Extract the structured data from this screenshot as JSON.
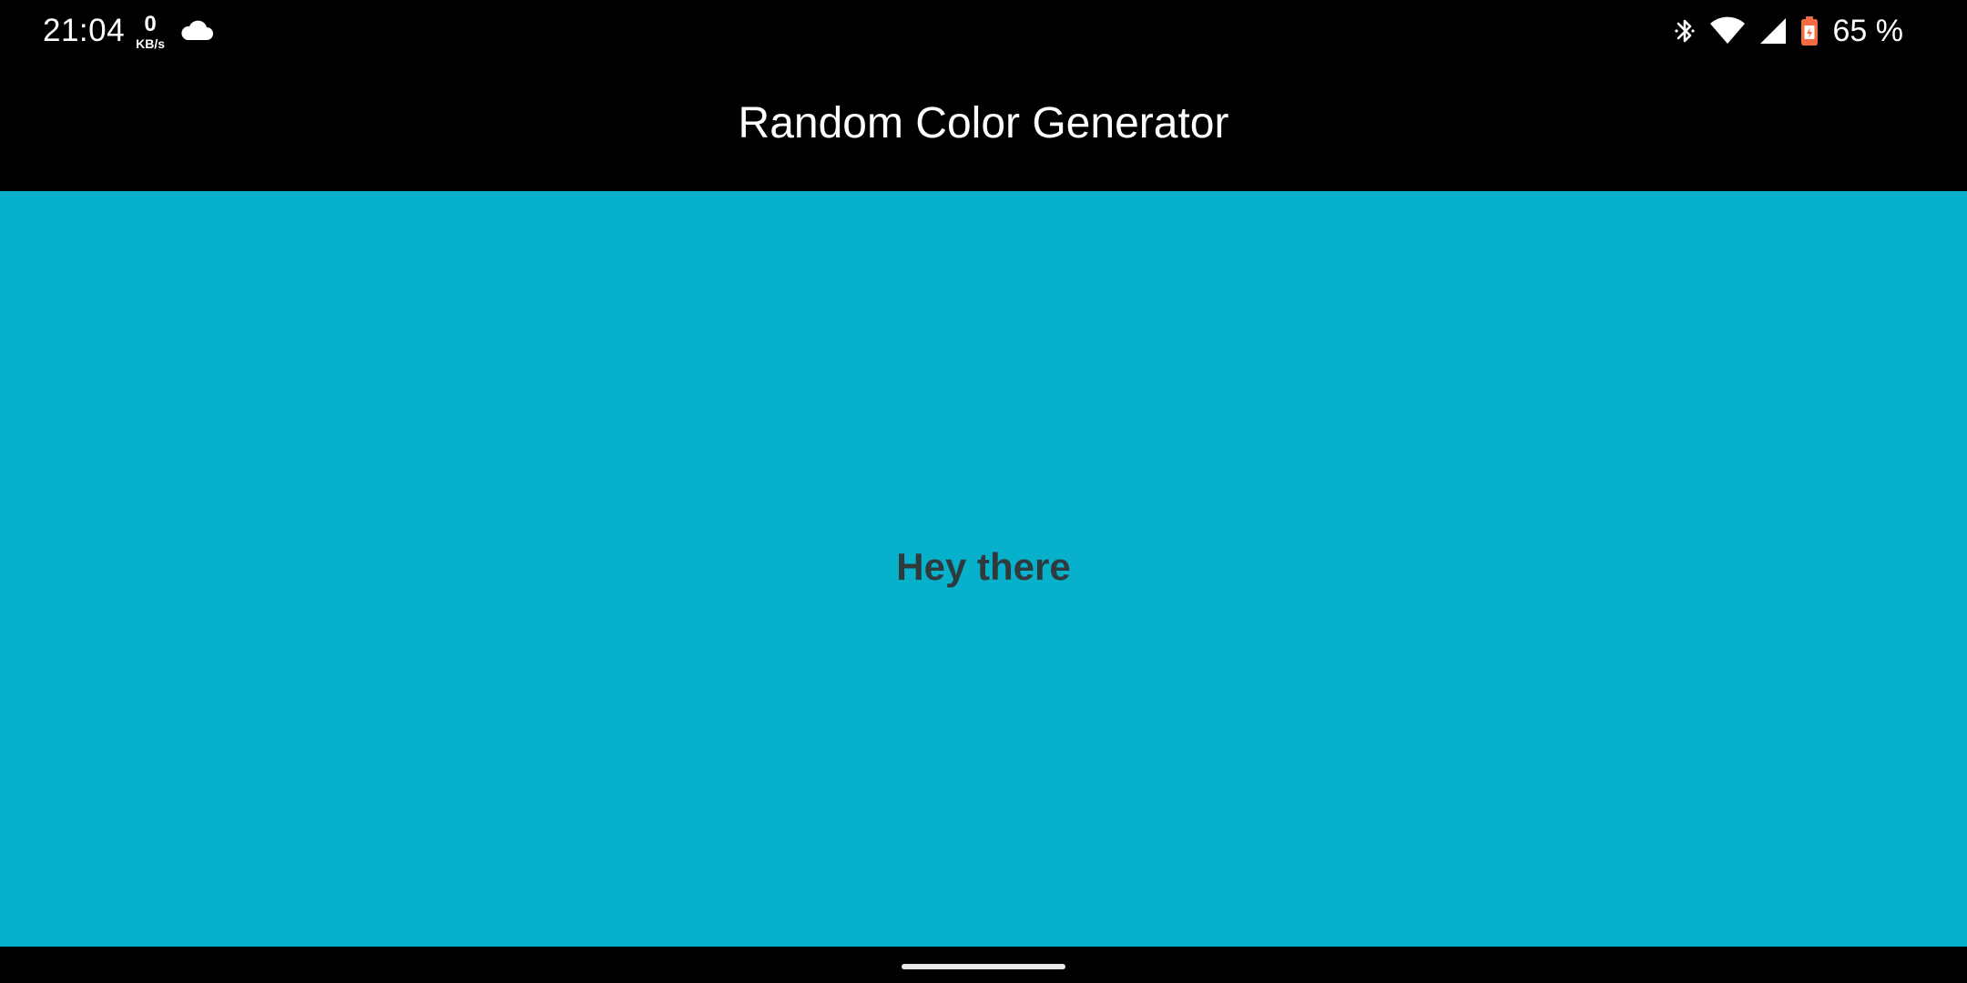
{
  "status_bar": {
    "time": "21:04",
    "net_speed_value": "0",
    "net_speed_unit": "KB/s",
    "cloud_icon": "cloud-icon",
    "bluetooth_icon": "bluetooth-icon",
    "wifi_icon": "wifi-icon",
    "signal_icon": "cell-signal-icon",
    "battery_icon": "battery-charging-icon",
    "battery_percent": "65 %",
    "battery_color": "#f26b43"
  },
  "app_bar": {
    "title": "Random Color Generator"
  },
  "content": {
    "background_color": "#08b1cb",
    "text": "Hey there",
    "text_color": "#2f3a3d"
  },
  "nav_bar": {
    "home_handle": "home-gesture-handle"
  }
}
